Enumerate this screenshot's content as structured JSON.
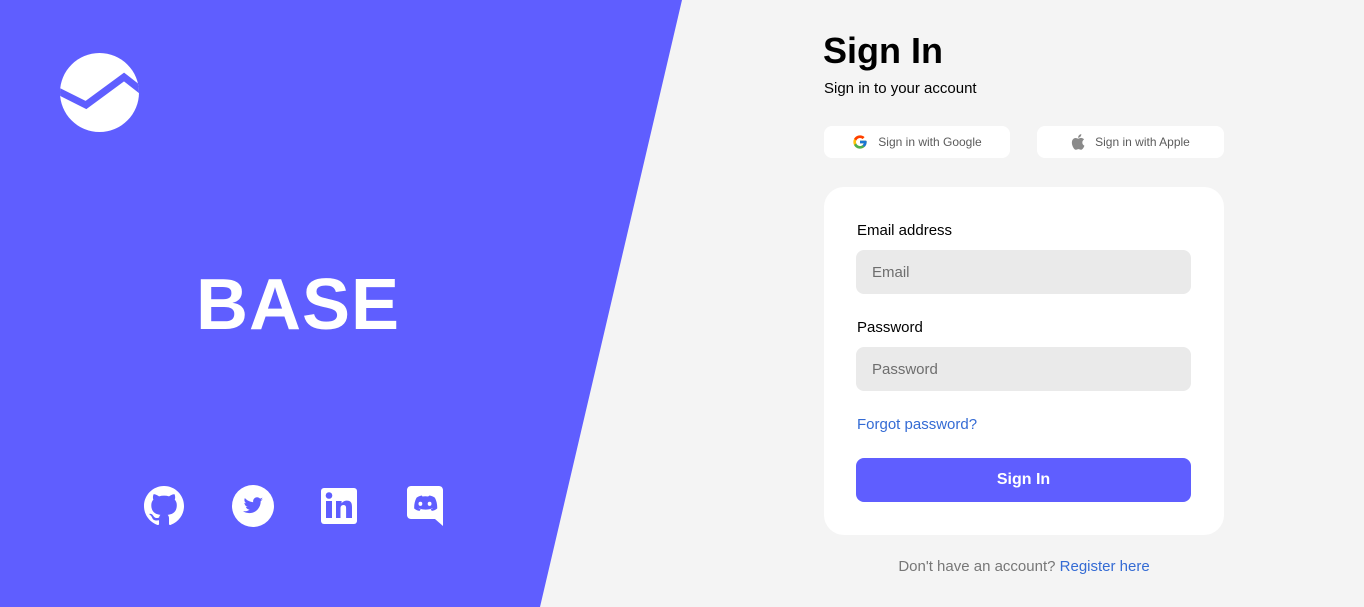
{
  "brand": {
    "name": "BASE",
    "logo_icon": "chart-line-logo-icon",
    "accent_color": "#5f5eff"
  },
  "socials": [
    {
      "icon": "github-icon"
    },
    {
      "icon": "twitter-icon"
    },
    {
      "icon": "linkedin-icon"
    },
    {
      "icon": "discord-icon"
    }
  ],
  "signin": {
    "title": "Sign In",
    "subtitle": "Sign in to your account",
    "google_label": "Sign in with Google",
    "apple_label": "Sign in with Apple"
  },
  "form": {
    "email_label": "Email address",
    "email_placeholder": "Email",
    "password_label": "Password",
    "password_placeholder": "Password",
    "forgot_label": "Forgot password?",
    "submit_label": "Sign In",
    "link_color": "#346bd4"
  },
  "footer": {
    "prompt": "Don't have an account?",
    "register_label": "Register here"
  }
}
